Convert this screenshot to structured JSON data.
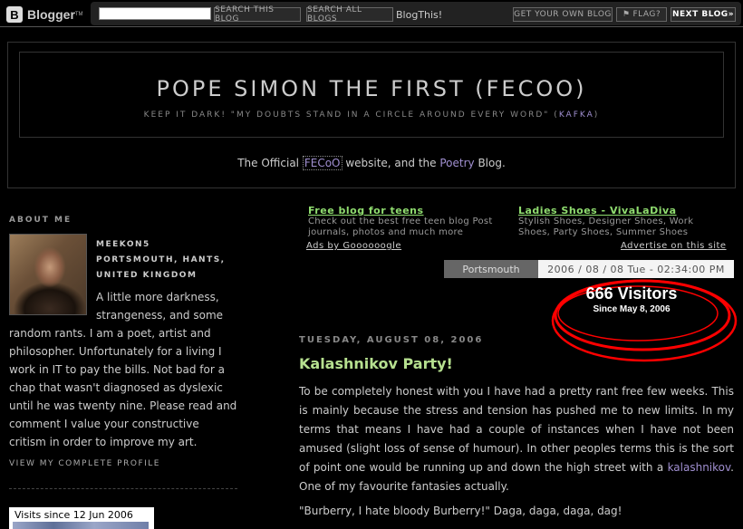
{
  "navbar": {
    "logo_letter": "B",
    "logo_text": "Blogger",
    "logo_tm": "TM",
    "search_this_blog": "SEARCH THIS BLOG",
    "search_all_blogs": "SEARCH ALL BLOGS",
    "blogthis": "BlogThis!",
    "get_your_own": "GET YOUR OWN BLOG",
    "flag": "FLAG?",
    "next_blog": "NEXT BLOG»"
  },
  "header": {
    "title": "POPE SIMON THE FIRST (FECOO)",
    "description_prefix": "KEEP IT DARK! \"MY DOUBTS STAND IN A CIRCLE AROUND EVERY WORD\" (",
    "description_link": "KAFKA",
    "description_suffix": ")",
    "official_prefix": "The Official ",
    "official_link": "FECoO",
    "official_middle": " website, and the ",
    "official_poetry": "Poetry",
    "official_suffix": " Blog."
  },
  "sidebar": {
    "about_heading": "ABOUT ME",
    "profile_name_1": "MEEKON5",
    "profile_name_2": "PORTSMOUTH, HANTS,",
    "profile_name_3": "UNITED KINGDOM",
    "profile_text": "A little more darkness, strangeness, and some random rants. I am a poet, artist and philosopher. Unfortunately for a living I work in IT to pay the bills. Not bad for a chap that wasn't diagnosed as dyslexic until he was twenty nine. Please read and comment I value your constructive critism in order to improve my art.",
    "view_profile": "VIEW MY COMPLETE PROFILE",
    "visits_label": "Visits since 12 Jun 2006"
  },
  "ads": {
    "ad1_title": "Free blog for teens",
    "ad1_line1": "Check out the best free teen blog Post",
    "ad1_line2": "journals, photos and much more",
    "ad2_title": "Ladies Shoes - VivaLaDiva",
    "ad2_line1": "Stylish Shoes, Designer Shoes, Work",
    "ad2_line2": "Shoes, Party Shoes, Summer Shoes",
    "ads_by": "Ads by Goooooogle",
    "advertise": "Advertise on this site"
  },
  "location": {
    "city": "Portsmouth",
    "datetime": "2006 / 08 / 08  Tue - 02:34:00 PM"
  },
  "counter": {
    "visitors": "666 Visitors",
    "since": "Since May 8, 2006"
  },
  "post": {
    "date": "TUESDAY, AUGUST 08, 2006",
    "title": "Kalashnikov Party!",
    "body_before": "To be completely honest with you I have had a pretty rant free few weeks. This is mainly because the stress and tension has pushed me to new limits. In my terms that means I have had a couple of instances when I have not been amused (slight loss of sense of humour). In other peoples terms this is the sort of point one would be running up and down the high street with a ",
    "body_link": "kalashnikov",
    "body_after": ". One of my favourite fantasies actually.",
    "p2": "\"Burberry, I hate bloody Burberry!\" Daga, daga, daga, dag!"
  },
  "colors": {
    "background": "#000000",
    "link_purple": "#a08fd0",
    "title_green": "#b6e08f",
    "ad_green": "#8fdc6f",
    "circle_red": "#ff0000"
  }
}
